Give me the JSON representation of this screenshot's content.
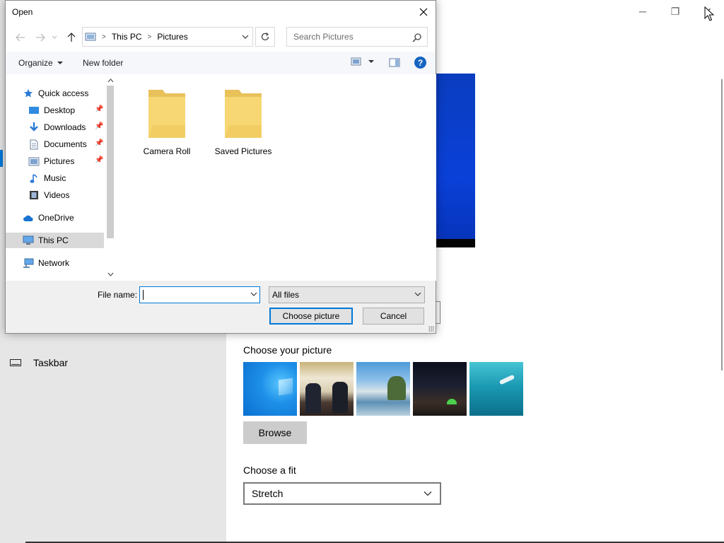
{
  "settings": {
    "sidebar_item_label": "Taskbar",
    "choose_picture_heading": "Choose your picture",
    "browse_label": "Browse",
    "choose_fit_heading": "Choose a fit",
    "fit_value": "Stretch",
    "window_controls": {
      "minimize": "─",
      "maximize": "❐",
      "close": "✕"
    }
  },
  "dialog": {
    "title": "Open",
    "close_glyph": "✕",
    "address": {
      "crumbs": [
        "This PC",
        "Pictures"
      ]
    },
    "search": {
      "placeholder": "Search Pictures"
    },
    "toolbar": {
      "organize": "Organize",
      "new_folder": "New folder",
      "help": "?"
    },
    "nav": {
      "items": [
        {
          "label": "Quick access",
          "icon": "star-icon",
          "pinned": false
        },
        {
          "label": "Desktop",
          "icon": "desktop-icon",
          "pinned": true
        },
        {
          "label": "Downloads",
          "icon": "download-icon",
          "pinned": true
        },
        {
          "label": "Documents",
          "icon": "document-icon",
          "pinned": true
        },
        {
          "label": "Pictures",
          "icon": "pictures-icon",
          "pinned": true
        },
        {
          "label": "Music",
          "icon": "music-icon",
          "pinned": false
        },
        {
          "label": "Videos",
          "icon": "video-icon",
          "pinned": false
        },
        {
          "label": "OneDrive",
          "icon": "cloud-icon",
          "pinned": false
        },
        {
          "label": "This PC",
          "icon": "computer-icon",
          "pinned": false,
          "selected": true
        },
        {
          "label": "Network",
          "icon": "network-icon",
          "pinned": false
        }
      ]
    },
    "folders": [
      {
        "label": "Camera Roll"
      },
      {
        "label": "Saved Pictures"
      }
    ],
    "file_name_label": "File name:",
    "file_name_value": "",
    "file_type_value": "All files",
    "choose_button": "Choose picture",
    "cancel_button": "Cancel"
  },
  "colors": {
    "accent": "#0078d7",
    "folder": "#f4d06a"
  }
}
